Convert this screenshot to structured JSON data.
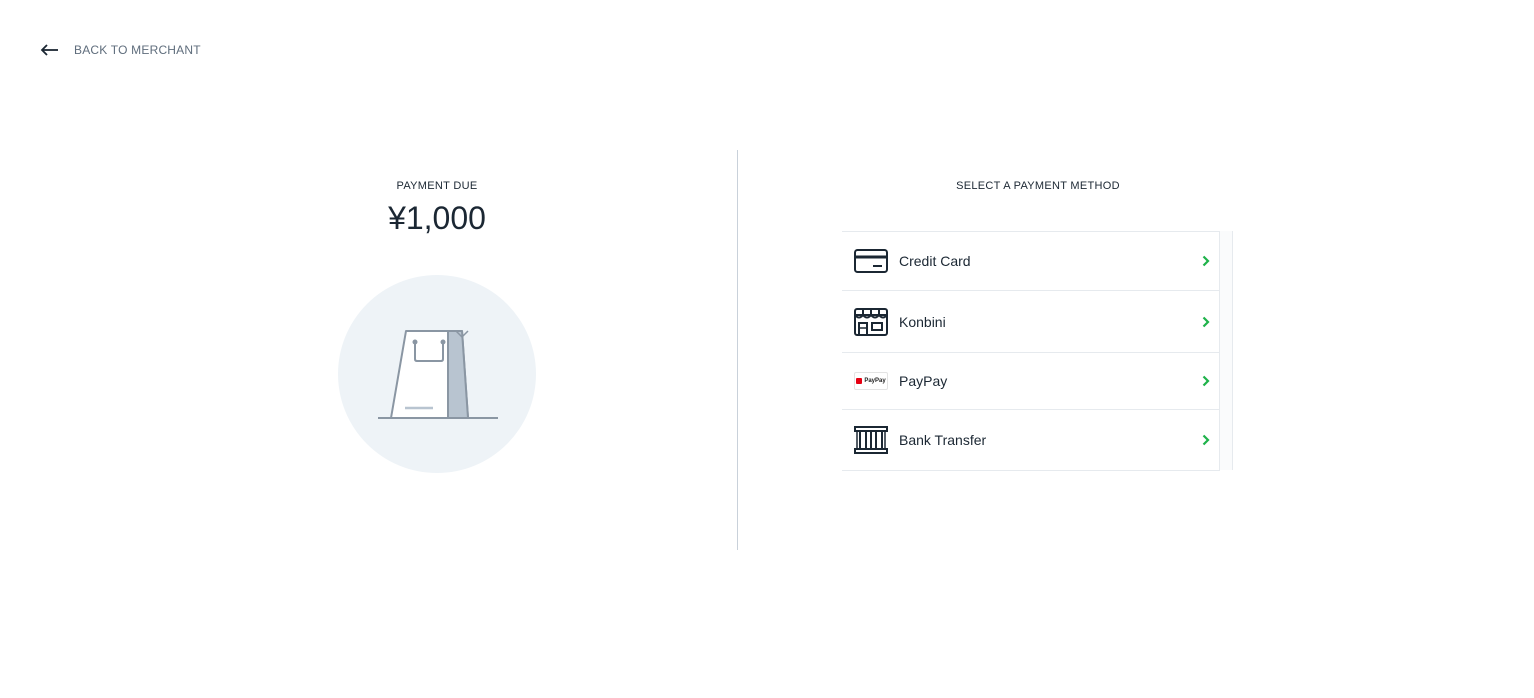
{
  "header": {
    "back_label": "BACK TO MERCHANT",
    "back_icon": "arrow-left-icon"
  },
  "payment": {
    "due_label": "PAYMENT DUE",
    "amount": "¥1,000",
    "illustration_icon": "shopping-bag-icon"
  },
  "methods": {
    "title": "SELECT A PAYMENT METHOD",
    "items": [
      {
        "label": "Credit Card",
        "icon": "credit-card-icon"
      },
      {
        "label": "Konbini",
        "icon": "convenience-store-icon"
      },
      {
        "label": "PayPay",
        "icon": "paypay-logo-icon",
        "logo_text": "PayPay"
      },
      {
        "label": "Bank Transfer",
        "icon": "bank-icon"
      }
    ],
    "chevron_icon": "chevron-right-icon"
  },
  "colors": {
    "accent": "#1fb24a",
    "text": "#1b2733",
    "muted": "#5f6d7c",
    "divider": "#c9d1da",
    "circle": "#eef3f7",
    "paypay_red": "#e60012"
  }
}
